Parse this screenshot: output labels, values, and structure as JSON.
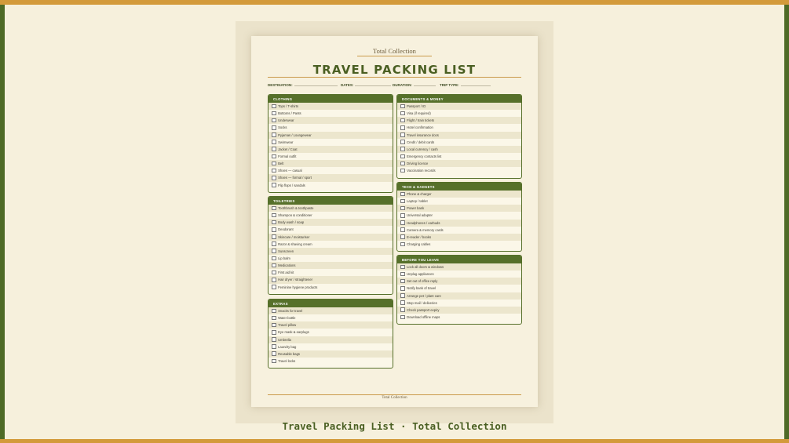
{
  "brand": "Total Collection",
  "title": "TRAVEL PACKING LIST",
  "meta": {
    "destination": "DESTINATION:",
    "dates": "DATES:",
    "duration": "DURATION:",
    "trip_type": "TRIP TYPE:"
  },
  "sections": {
    "clothing": {
      "title": "CLOTHING",
      "items": [
        "Tops / T-shirts",
        "Bottoms / Pants",
        "Underwear",
        "Socks",
        "Pyjamas / Loungewear",
        "Swimwear",
        "Jacket / Coat",
        "Formal outfit",
        "Belt",
        "Shoes — casual",
        "Shoes — formal / sport",
        "Flip flops / sandals"
      ]
    },
    "toiletries": {
      "title": "TOILETRIES",
      "items": [
        "Toothbrush & toothpaste",
        "Shampoo & conditioner",
        "Body wash / soap",
        "Deodorant",
        "Skincare / moisturiser",
        "Razor & shaving cream",
        "Sunscreen",
        "Lip balm",
        "Medications",
        "First aid kit",
        "Hair dryer / straightener",
        "Feminine hygiene products"
      ]
    },
    "extras": {
      "title": "EXTRAS",
      "items": [
        "Snacks for travel",
        "Water bottle",
        "Travel pillow",
        "Eye mask & earplugs",
        "Umbrella",
        "Laundry bag",
        "Reusable bags",
        "Travel locks"
      ]
    },
    "documents": {
      "title": "DOCUMENTS & MONEY",
      "items": [
        "Passport / ID",
        "Visa (if required)",
        "Flight / train tickets",
        "Hotel confirmation",
        "Travel insurance docs",
        "Credit / debit cards",
        "Local currency / cash",
        "Emergency contacts list",
        "Driving licence",
        "Vaccination records"
      ]
    },
    "tech": {
      "title": "TECH & GADGETS",
      "items": [
        "Phone & charger",
        "Laptop / tablet",
        "Power bank",
        "Universal adapter",
        "Headphones / earbuds",
        "Camera & memory cards",
        "E-reader / books",
        "Charging cables"
      ]
    },
    "before": {
      "title": "BEFORE YOU LEAVE",
      "items": [
        "Lock all doors & windows",
        "Unplug appliances",
        "Set out of office reply",
        "Notify bank of travel",
        "Arrange pet / plant care",
        "Stop mail / deliveries",
        "Check passport expiry",
        "Download offline maps"
      ]
    }
  },
  "footer": "Total Collection",
  "caption": "Travel Packing List · Total Collection"
}
